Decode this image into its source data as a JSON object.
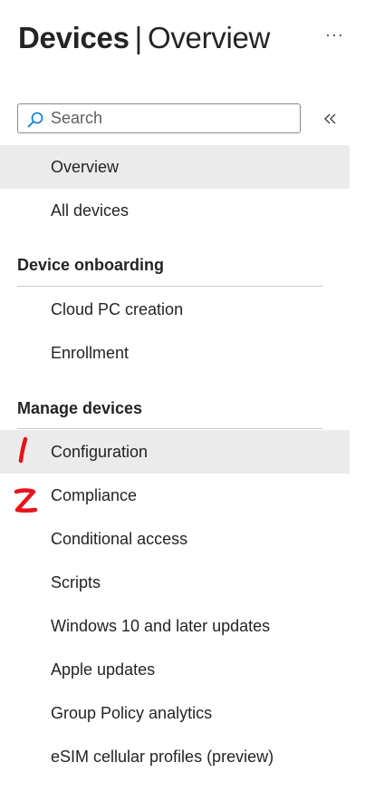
{
  "header": {
    "title_main": "Devices",
    "title_separator": "|",
    "title_sub": "Overview",
    "more_label": "···"
  },
  "search": {
    "placeholder": "Search",
    "value": ""
  },
  "icons": {
    "search": "search-icon",
    "collapse": "double-chevron-left-icon",
    "more": "more-horizontal-icon"
  },
  "colors": {
    "accent": "#0078d4",
    "selected_bg": "#ebebeb",
    "annotation": "#e8121b"
  },
  "nav": {
    "top_items": [
      {
        "label": "Overview",
        "selected": true
      },
      {
        "label": "All devices",
        "selected": false
      }
    ],
    "sections": [
      {
        "title": "Device onboarding",
        "items": [
          {
            "label": "Cloud PC creation",
            "selected": false
          },
          {
            "label": "Enrollment",
            "selected": false
          }
        ]
      },
      {
        "title": "Manage devices",
        "items": [
          {
            "label": "Configuration",
            "selected": true
          },
          {
            "label": "Compliance",
            "selected": false
          },
          {
            "label": "Conditional access",
            "selected": false
          },
          {
            "label": "Scripts",
            "selected": false
          },
          {
            "label": "Windows 10 and later updates",
            "selected": false
          },
          {
            "label": "Apple updates",
            "selected": false
          },
          {
            "label": "Group Policy analytics",
            "selected": false
          },
          {
            "label": "eSIM cellular profiles (preview)",
            "selected": false
          }
        ]
      }
    ]
  },
  "annotations": [
    "1",
    "2"
  ]
}
